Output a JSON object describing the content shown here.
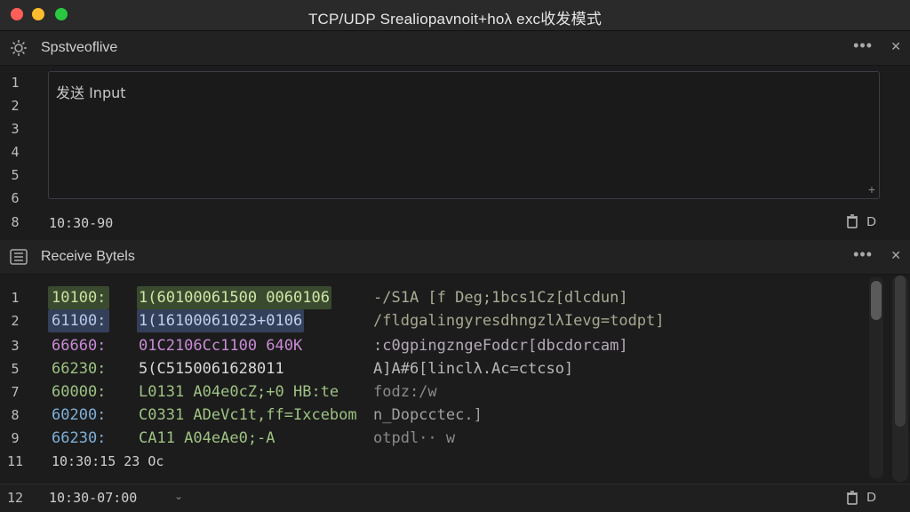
{
  "window": {
    "title": "TCP/UDP Srealiopavnoit+hoλ exc收发模式"
  },
  "send_panel": {
    "title": "Spstveoflive",
    "more": "•••",
    "close": "✕",
    "input_placeholder": "发送 Input",
    "line_numbers": [
      "1",
      "2",
      "3",
      "4",
      "5",
      "6"
    ],
    "status_line": "8",
    "status_time": "10:30-90",
    "status_d": "D"
  },
  "receive_panel": {
    "title": "Receive Bytels",
    "more": "•••",
    "close": "✕",
    "rows": [
      {
        "ln": "1",
        "addr": "10100:",
        "hex": "1(60100061500 0060106",
        "ascii": "-/S1A [f Deg;1bcs1Cz[dlcdun]",
        "addr_bg": "#3a4a2e",
        "hex_bg": "#3a4a2e",
        "addr_color": "#c7e0a0",
        "hex_color": "#cfe6a8"
      },
      {
        "ln": "2",
        "addr": "61100:",
        "hex": "1(16100061023+0106",
        "ascii": "/fldgalingyresdhngzlλIevg=todpt]",
        "addr_bg": "#34405a",
        "hex_bg": "#34405a",
        "addr_color": "#b8c8e8",
        "hex_color": "#c0cfee"
      },
      {
        "ln": "3",
        "addr": "66660:",
        "hex": "01C2106Cc1100 640K",
        "ascii": ":c0gpingzngeFodcr[dbcdorcam]",
        "addr_bg": "",
        "hex_bg": "",
        "addr_color": "#c98bd6",
        "hex_color": "#c98bd6"
      },
      {
        "ln": "5",
        "addr": "66230:",
        "hex": "5(C5150061628011",
        "ascii": "A]A#6[linclλ.Ac=ctcso]",
        "addr_bg": "",
        "hex_bg": "",
        "addr_color": "#9ec283",
        "hex_color": "#d8d8d8"
      },
      {
        "ln": "7",
        "addr": "60000:",
        "hex": "L0131 A04e0cZ;+0 HB:te",
        "ascii": "fodz:/w",
        "addr_bg": "",
        "hex_bg": "",
        "addr_color": "#9ec283",
        "hex_color": "#9ec283"
      },
      {
        "ln": "8",
        "addr": "60200:",
        "hex": "C0331 ADeVc1t,ff=Ixcebom",
        "ascii": "n_Dopcctec.]",
        "addr_bg": "",
        "hex_bg": "",
        "addr_color": "#7fb0d8",
        "hex_color": "#9ec283"
      },
      {
        "ln": "9",
        "addr": "66230:",
        "hex": "CA11 A04eAe0;-A",
        "ascii": "otpdl·· w",
        "addr_bg": "",
        "hex_bg": "",
        "addr_color": "#7fb0d8",
        "hex_color": "#9ec283"
      },
      {
        "ln": "11",
        "addr": "10:30:15 23 Oc",
        "hex": "",
        "ascii": "",
        "addr_bg": "",
        "hex_bg": "",
        "addr_color": "#cfcfcf",
        "hex_color": "#cfcfcf"
      }
    ],
    "bottom_line": "12",
    "bottom_time": "10:30-07:00",
    "bottom_d": "D"
  },
  "icons": {
    "send_header": "gear-icon",
    "receive_header": "list-icon",
    "trash": "trash-icon",
    "resize": "resize-grip-icon"
  }
}
